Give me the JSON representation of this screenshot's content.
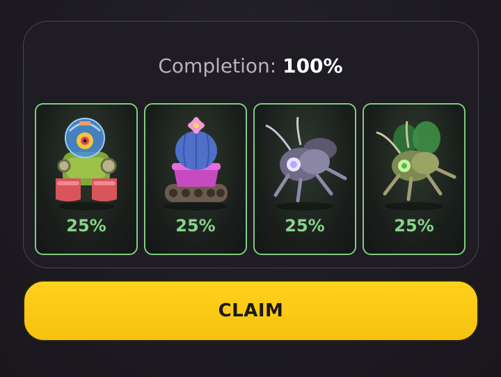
{
  "completion": {
    "label": "Completion:",
    "value": "100%"
  },
  "cards": [
    {
      "icon": "diver-robot-icon",
      "percent": "25%"
    },
    {
      "icon": "cactus-tank-icon",
      "percent": "25%"
    },
    {
      "icon": "purple-mech-bug-icon",
      "percent": "25%"
    },
    {
      "icon": "green-mech-bug-icon",
      "percent": "25%"
    }
  ],
  "claim_button": {
    "label": "CLAIM"
  },
  "colors": {
    "accent_green": "#86d48a",
    "card_border": "#7ccf7e",
    "claim_yellow": "#f8c512",
    "background": "#1e1b22"
  }
}
